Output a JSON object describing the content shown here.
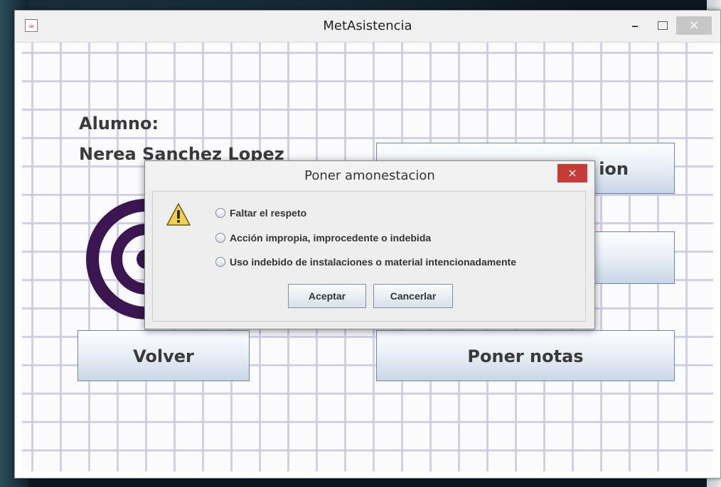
{
  "window": {
    "title": "MetAsistencia",
    "minimize_label": "–",
    "close_label": "×"
  },
  "main": {
    "alumno_label": "Alumno:",
    "student_name": "Nerea Sanchez Lopez",
    "top_button_label": "ion",
    "volver_button_label": "Volver",
    "poner_notas_button_label": "Poner notas"
  },
  "dialog": {
    "title": "Poner amonestacion",
    "close_label": "×",
    "options": [
      "Faltar el respeto",
      "Acción impropia, improcedente o indebida",
      "Uso indebido de instalaciones o material intencionadamente"
    ],
    "accept_label": "Aceptar",
    "cancel_label": "Cancerlar"
  },
  "colors": {
    "logo": "#3b1650",
    "grid": "#cfcfe6",
    "close_red": "#c63b36"
  },
  "icons": [
    "java-app-icon",
    "warning-icon",
    "logo-icon"
  ]
}
